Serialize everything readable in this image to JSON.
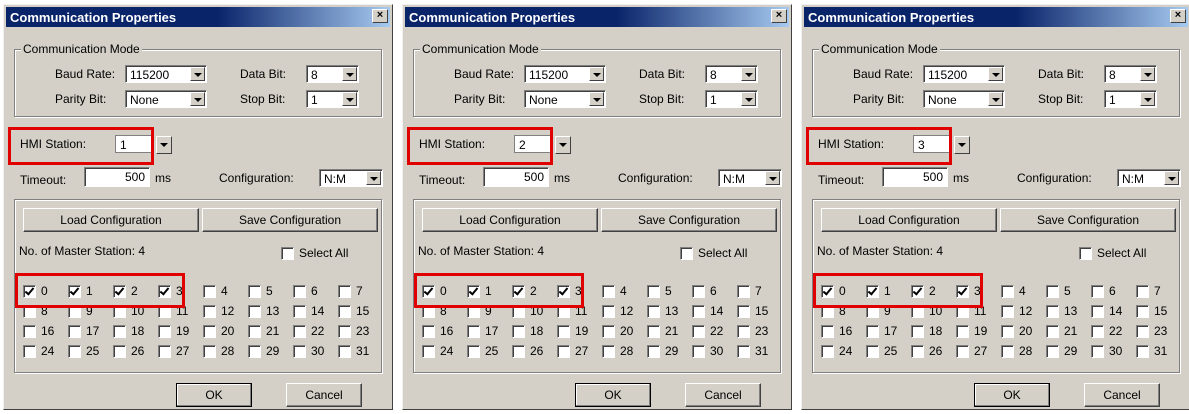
{
  "dialogs": [
    {
      "title": "Communication Properties",
      "close_glyph": "×",
      "comm_mode": {
        "legend": "Communication Mode",
        "baud_label": "Baud Rate:",
        "baud_value": "115200",
        "databit_label": "Data Bit:",
        "databit_value": "8",
        "parity_label": "Parity Bit:",
        "parity_value": "None",
        "stopbit_label": "Stop Bit:",
        "stopbit_value": "1"
      },
      "hmi_label": "HMI Station:",
      "hmi_value": "1",
      "timeout_label": "Timeout:",
      "timeout_value": "500",
      "timeout_unit": "ms",
      "config_label": "Configuration:",
      "config_value": "N:M",
      "load_btn": "Load Configuration",
      "save_btn": "Save Configuration",
      "master_label": "No. of Master Station:  4",
      "select_all": "Select All",
      "stations": [
        "0",
        "1",
        "2",
        "3",
        "4",
        "5",
        "6",
        "7",
        "8",
        "9",
        "10",
        "11",
        "12",
        "13",
        "14",
        "15",
        "16",
        "17",
        "18",
        "19",
        "20",
        "21",
        "22",
        "23",
        "24",
        "25",
        "26",
        "27",
        "28",
        "29",
        "30",
        "31"
      ],
      "checked": [
        0,
        1,
        2,
        3
      ],
      "ok_btn": "OK",
      "cancel_btn": "Cancel"
    },
    {
      "title": "Communication Properties",
      "close_glyph": "×",
      "comm_mode": {
        "legend": "Communication Mode",
        "baud_label": "Baud Rate:",
        "baud_value": "115200",
        "databit_label": "Data Bit:",
        "databit_value": "8",
        "parity_label": "Parity Bit:",
        "parity_value": "None",
        "stopbit_label": "Stop Bit:",
        "stopbit_value": "1"
      },
      "hmi_label": "HMI Station:",
      "hmi_value": "2",
      "timeout_label": "Timeout:",
      "timeout_value": "500",
      "timeout_unit": "ms",
      "config_label": "Configuration:",
      "config_value": "N:M",
      "load_btn": "Load Configuration",
      "save_btn": "Save Configuration",
      "master_label": "No. of Master Station:  4",
      "select_all": "Select All",
      "stations": [
        "0",
        "1",
        "2",
        "3",
        "4",
        "5",
        "6",
        "7",
        "8",
        "9",
        "10",
        "11",
        "12",
        "13",
        "14",
        "15",
        "16",
        "17",
        "18",
        "19",
        "20",
        "21",
        "22",
        "23",
        "24",
        "25",
        "26",
        "27",
        "28",
        "29",
        "30",
        "31"
      ],
      "checked": [
        0,
        1,
        2,
        3
      ],
      "ok_btn": "OK",
      "cancel_btn": "Cancel"
    },
    {
      "title": "Communication Properties",
      "close_glyph": "×",
      "comm_mode": {
        "legend": "Communication Mode",
        "baud_label": "Baud Rate:",
        "baud_value": "115200",
        "databit_label": "Data Bit:",
        "databit_value": "8",
        "parity_label": "Parity Bit:",
        "parity_value": "None",
        "stopbit_label": "Stop Bit:",
        "stopbit_value": "1"
      },
      "hmi_label": "HMI Station:",
      "hmi_value": "3",
      "timeout_label": "Timeout:",
      "timeout_value": "500",
      "timeout_unit": "ms",
      "config_label": "Configuration:",
      "config_value": "N:M",
      "load_btn": "Load Configuration",
      "save_btn": "Save Configuration",
      "master_label": "No. of Master Station:  4",
      "select_all": "Select All",
      "stations": [
        "0",
        "1",
        "2",
        "3",
        "4",
        "5",
        "6",
        "7",
        "8",
        "9",
        "10",
        "11",
        "12",
        "13",
        "14",
        "15",
        "16",
        "17",
        "18",
        "19",
        "20",
        "21",
        "22",
        "23",
        "24",
        "25",
        "26",
        "27",
        "28",
        "29",
        "30",
        "31"
      ],
      "checked": [
        0,
        1,
        2,
        3
      ],
      "ok_btn": "OK",
      "cancel_btn": "Cancel"
    }
  ],
  "highlight_color": "#e00000"
}
